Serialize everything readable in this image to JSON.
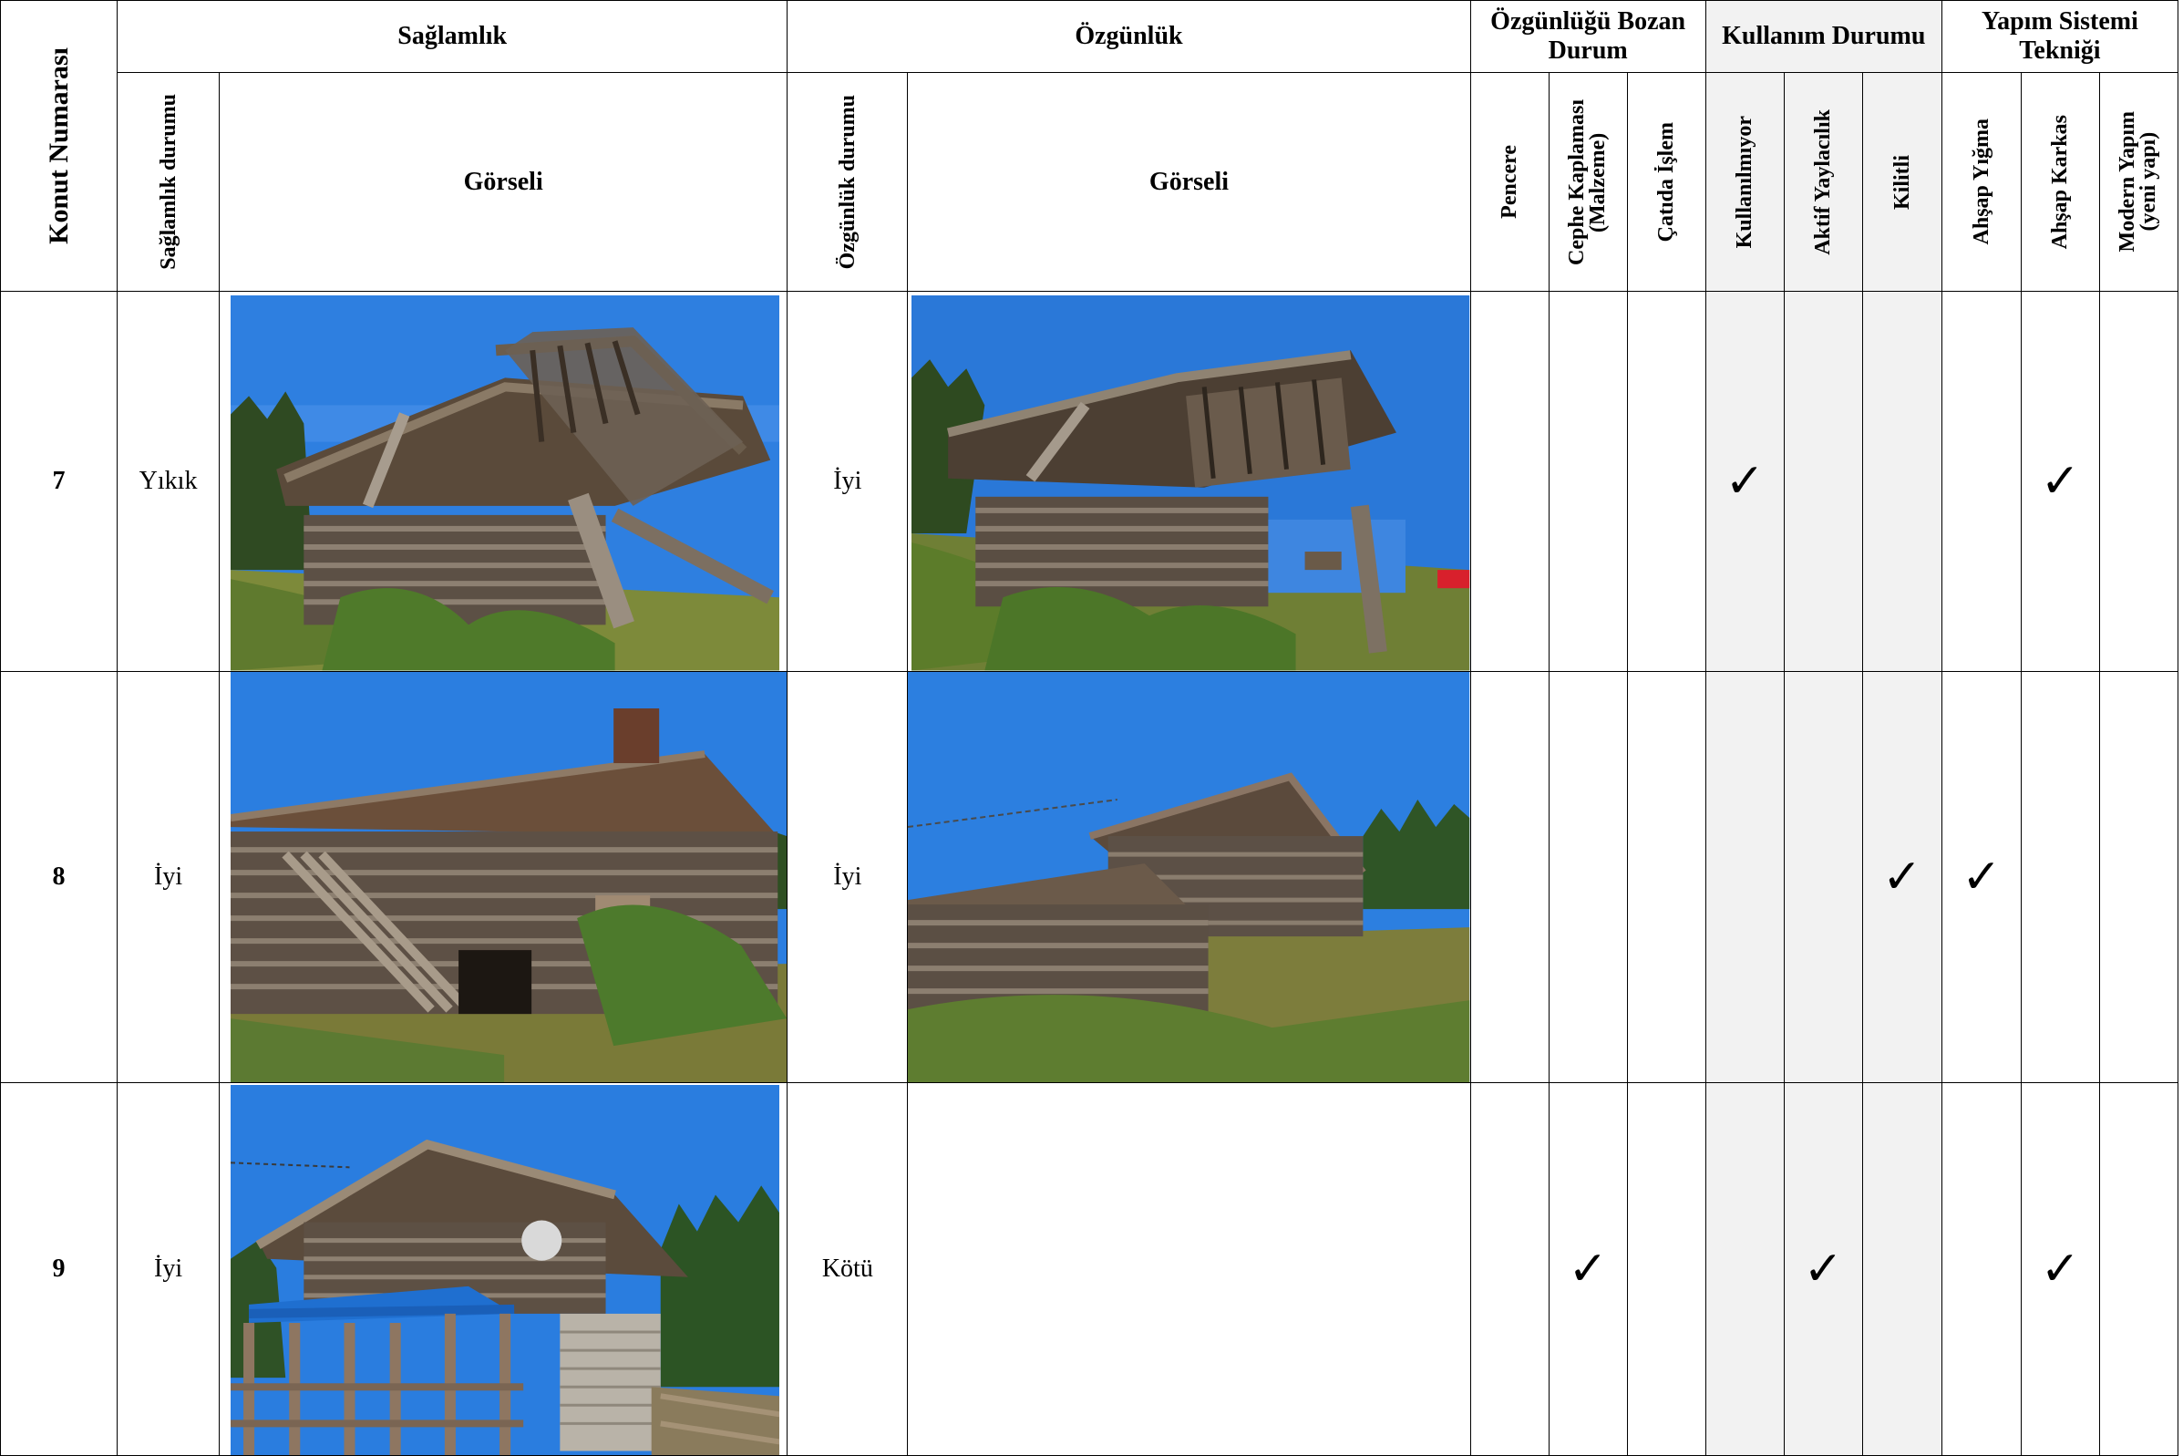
{
  "headers": {
    "konut_no": "Konut Numarası",
    "saglamlik": "Sağlamlık",
    "ozgunluk": "Özgünlük",
    "ozgunlugu_bozan": "Özgünlüğü Bozan Durum",
    "kullanim": "Kullanım Durumu",
    "yapim": "Yapım Sistemi Tekniği",
    "saglamlik_durumu": "Sağlamlık durumu",
    "saglamlik_gorseli": "Görseli",
    "ozgunluk_durumu": "Özgünlük durumu",
    "ozgunluk_gorseli": "Görseli",
    "pencere": "Pencere",
    "cephe_1": "Cephe Kaplaması",
    "cephe_2": "(Malzeme)",
    "catida": "Çatıda İşlem",
    "kullanilmiyor": "Kullanılmıyor",
    "aktif": "Aktif Yaylacılık",
    "kilitli": "Kilitli",
    "ahsap_yigma": "Ahşap Yığma",
    "ahsap_karkas": "Ahşap Karkas",
    "modern_1": "Modern Yapım",
    "modern_2": "(yeni yapı)"
  },
  "check_symbol": "✓",
  "rows": [
    {
      "no": "7",
      "saglamlik": "Yıkık",
      "ozgunluk": "İyi",
      "checks": {
        "pencere": "",
        "cephe": "",
        "catida": "",
        "kullanilmiyor": "✓",
        "aktif": "",
        "kilitli": "",
        "yigma": "",
        "karkas": "✓",
        "modern": ""
      }
    },
    {
      "no": "8",
      "saglamlik": "İyi",
      "ozgunluk": "İyi",
      "checks": {
        "pencere": "",
        "cephe": "",
        "catida": "",
        "kullanilmiyor": "",
        "aktif": "",
        "kilitli": "✓",
        "yigma": "✓",
        "karkas": "",
        "modern": ""
      }
    },
    {
      "no": "9",
      "saglamlik": "İyi",
      "ozgunluk": "Kötü",
      "checks": {
        "pencere": "",
        "cephe": "✓",
        "catida": "",
        "kullanilmiyor": "",
        "aktif": "✓",
        "kilitli": "",
        "yigma": "",
        "karkas": "✓",
        "modern": ""
      }
    }
  ],
  "colors": {
    "sky": "#2a78d8",
    "wood_dark": "#4a3a2c",
    "wood_light": "#8a7a66",
    "grass": "#5f7a2e",
    "shade": "#f2f2f2"
  }
}
